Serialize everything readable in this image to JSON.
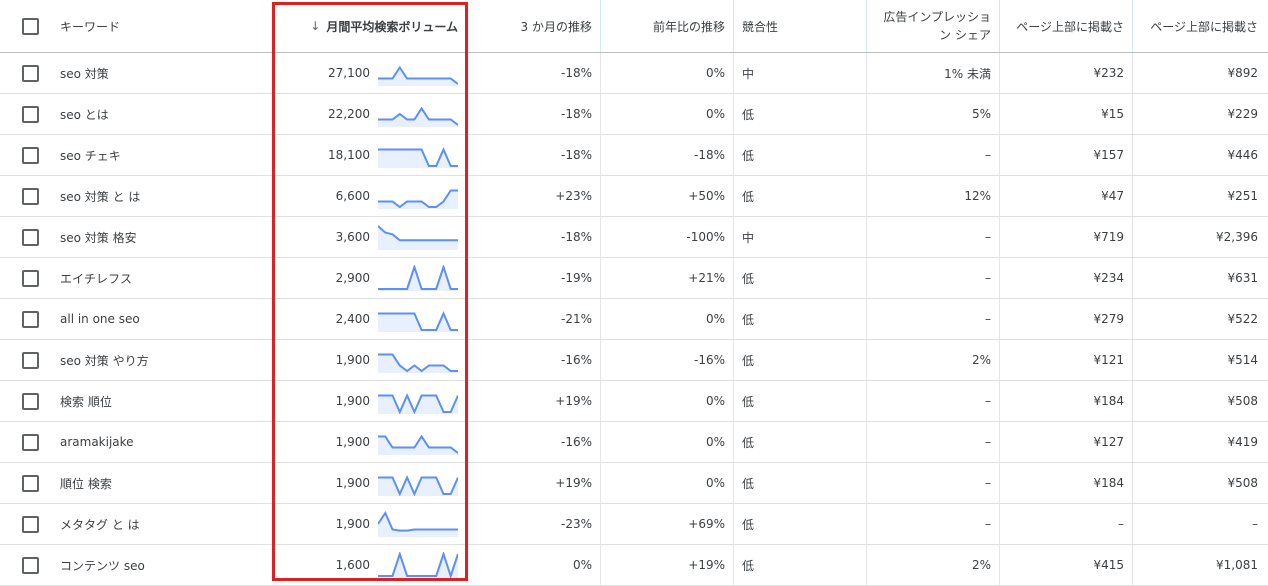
{
  "columns": {
    "keyword": "キーワード",
    "volume": "月間平均検索ボリューム",
    "three_month": "3 か月の推移",
    "yoy": "前年比の推移",
    "competition": "競合性",
    "impression_share": "広告インプレッション シェア",
    "bid_low": "ページ上部に掲載さ",
    "bid_high": "ページ上部に掲載さ"
  },
  "icons": {
    "sort": "arrow-down-icon",
    "checkbox": "checkbox-icon"
  },
  "colors": {
    "sparkline": "#5b8ff9",
    "sparkline_fill": "#e8f0fe",
    "highlight": "#e02020"
  },
  "rows": [
    {
      "keyword": "seo 対策",
      "volume": "27,100",
      "three_month": "-18%",
      "yoy": "0%",
      "competition": "中",
      "impression_share": "1% 未満",
      "bid_low": "¥232",
      "bid_high": "¥892",
      "trend": [
        3,
        3,
        3,
        1,
        3,
        3,
        3,
        3,
        3,
        3,
        3,
        4
      ]
    },
    {
      "keyword": "seo とは",
      "volume": "22,200",
      "three_month": "-18%",
      "yoy": "0%",
      "competition": "低",
      "impression_share": "5%",
      "bid_low": "¥15",
      "bid_high": "¥229",
      "trend": [
        3,
        3,
        3,
        2,
        3,
        3,
        1,
        3,
        3,
        3,
        3,
        4
      ]
    },
    {
      "keyword": "seo チェキ",
      "volume": "18,100",
      "three_month": "-18%",
      "yoy": "-18%",
      "competition": "低",
      "impression_share": "–",
      "bid_low": "¥157",
      "bid_high": "¥446",
      "trend": [
        1,
        1,
        1,
        1,
        1,
        1,
        1,
        4,
        4,
        1,
        4,
        4
      ]
    },
    {
      "keyword": "seo 対策 と は",
      "volume": "6,600",
      "three_month": "+23%",
      "yoy": "+50%",
      "competition": "低",
      "impression_share": "12%",
      "bid_low": "¥47",
      "bid_high": "¥251",
      "trend": [
        3,
        3,
        3,
        4,
        3,
        3,
        3,
        4,
        4,
        3,
        1,
        1
      ]
    },
    {
      "keyword": "seo 対策 格安",
      "volume": "3,600",
      "three_month": "-18%",
      "yoy": "-100%",
      "competition": "中",
      "impression_share": "–",
      "bid_low": "¥719",
      "bid_high": "¥2,396",
      "trend": [
        0,
        1.2,
        1.5,
        2.6,
        2.6,
        2.6,
        2.6,
        2.6,
        2.6,
        2.6,
        2.6,
        2.6
      ]
    },
    {
      "keyword": "エイチレフス",
      "volume": "2,900",
      "three_month": "-19%",
      "yoy": "+21%",
      "competition": "低",
      "impression_share": "–",
      "bid_low": "¥234",
      "bid_high": "¥631",
      "trend": [
        4,
        4,
        4,
        4,
        4,
        0,
        4,
        4,
        4,
        0,
        4,
        4
      ]
    },
    {
      "keyword": "all in one seo",
      "volume": "2,400",
      "three_month": "-21%",
      "yoy": "0%",
      "competition": "低",
      "impression_share": "–",
      "bid_low": "¥279",
      "bid_high": "¥522",
      "trend": [
        1,
        1,
        1,
        1,
        1,
        1,
        4,
        4,
        4,
        1,
        4,
        4
      ]
    },
    {
      "keyword": "seo 対策 やり方",
      "volume": "1,900",
      "three_month": "-16%",
      "yoy": "-16%",
      "competition": "低",
      "impression_share": "2%",
      "bid_low": "¥121",
      "bid_high": "¥514",
      "trend": [
        1,
        1,
        1,
        3,
        4,
        3,
        4,
        3,
        3,
        3,
        4,
        4
      ]
    },
    {
      "keyword": "検索 順位",
      "volume": "1,900",
      "three_month": "+19%",
      "yoy": "0%",
      "competition": "低",
      "impression_share": "–",
      "bid_low": "¥184",
      "bid_high": "¥508",
      "trend": [
        1,
        1,
        1,
        4,
        1,
        4,
        1,
        1,
        1,
        4,
        4,
        1
      ]
    },
    {
      "keyword": "aramakijake",
      "volume": "1,900",
      "three_month": "-16%",
      "yoy": "0%",
      "competition": "低",
      "impression_share": "–",
      "bid_low": "¥127",
      "bid_high": "¥419",
      "trend": [
        1,
        1,
        3,
        3,
        3,
        3,
        1,
        3,
        3,
        3,
        3,
        4
      ]
    },
    {
      "keyword": "順位 検索",
      "volume": "1,900",
      "three_month": "+19%",
      "yoy": "0%",
      "competition": "低",
      "impression_share": "–",
      "bid_low": "¥184",
      "bid_high": "¥508",
      "trend": [
        1,
        1,
        1,
        4,
        1,
        4,
        1,
        1,
        1,
        4,
        4,
        1
      ]
    },
    {
      "keyword": "メタタグ と は",
      "volume": "1,900",
      "three_month": "-23%",
      "yoy": "+69%",
      "competition": "低",
      "impression_share": "–",
      "bid_low": "–",
      "bid_high": "–",
      "trend": [
        2,
        0,
        3,
        3.2,
        3.2,
        3,
        3,
        3,
        3,
        3,
        3,
        3
      ]
    },
    {
      "keyword": "コンテンツ seo",
      "volume": "1,600",
      "three_month": "0%",
      "yoy": "+19%",
      "competition": "低",
      "impression_share": "2%",
      "bid_low": "¥415",
      "bid_high": "¥1,081",
      "trend": [
        4,
        4,
        4,
        0,
        4,
        4,
        4,
        4,
        4,
        0,
        4,
        0
      ]
    }
  ]
}
